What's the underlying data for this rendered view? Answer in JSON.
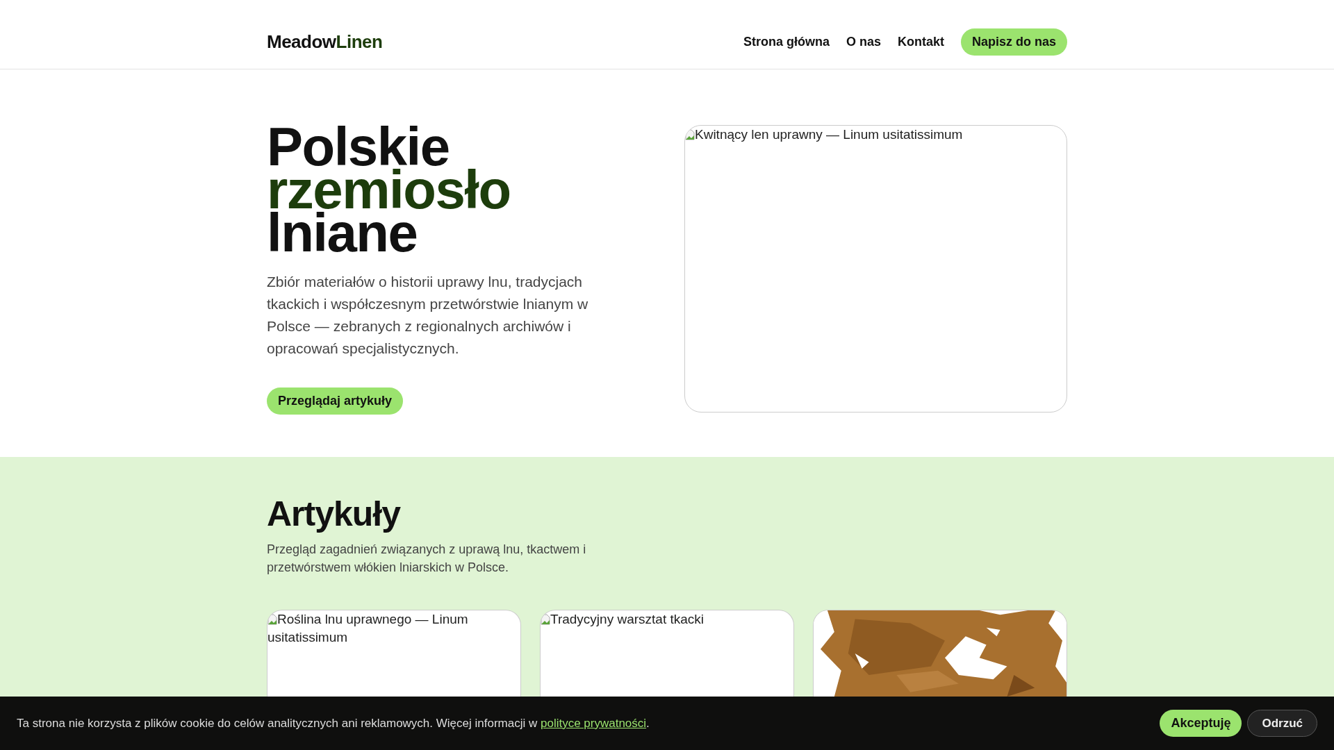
{
  "brand": {
    "parts": [
      {
        "text": "Meadow",
        "accent": false
      },
      {
        "text": "Linen",
        "accent": true
      }
    ]
  },
  "nav": {
    "links": [
      "Strona główna",
      "O nas",
      "Kontakt"
    ],
    "cta": "Napisz do nas"
  },
  "hero": {
    "title_lines": [
      {
        "text": "Polskie",
        "accent": false
      },
      {
        "text": "rzemiosło",
        "accent": true
      },
      {
        "text": "lniane",
        "accent": false
      }
    ],
    "lead": "Zbiór materiałów o historii uprawy lnu, tradycjach tkackich i współczesnym przetwórstwie lnianym w Polsce — zebranych z regionalnych archiwów i opracowań specjalistycznych.",
    "button": "Przeglądaj artykuły",
    "image": {
      "kind": "broken",
      "alt": "Kwitnący len uprawny — Linum usitatissimum"
    }
  },
  "articles": {
    "title": "Artykuły",
    "intro": "Przegląd zagadnień związanych z uprawą lnu, tkactwem i przetwórstwem włókien lniarskich w Polsce.",
    "cards": [
      {
        "kind": "broken",
        "alt": "Roślina lnu uprawnego — Linum usitatissimum"
      },
      {
        "kind": "broken",
        "alt": "Tradycyjny warsztat tkacki"
      },
      {
        "kind": "picture"
      }
    ]
  },
  "cookie_bar": {
    "text": "Ta strona nie korzysta z plików cookie do celów analitycznych ani reklamowych. Więcej informacji w ",
    "link": "polityce prywatności",
    "after": ".",
    "accept": "Akceptuję",
    "reject": "Odrzuć"
  }
}
